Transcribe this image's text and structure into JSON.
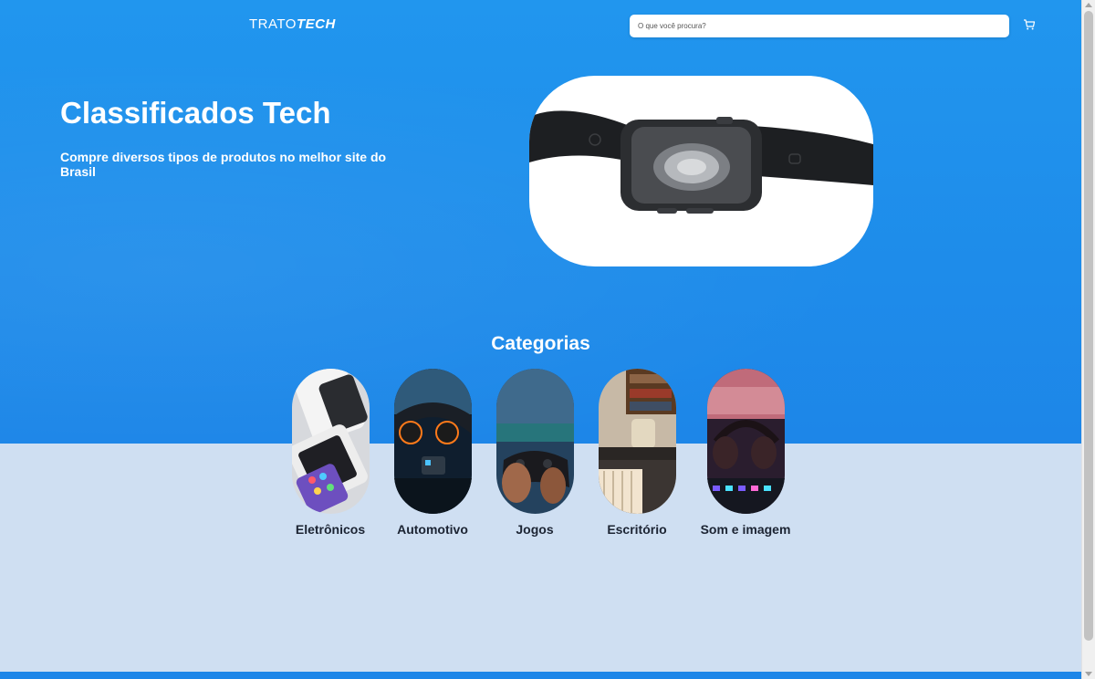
{
  "header": {
    "logo_light": "TRATO",
    "logo_bold": "TECH",
    "search_placeholder": "O que você procura?",
    "cart_icon": "cart-icon"
  },
  "hero": {
    "title": "Classificados Tech",
    "subtitle": "Compre diversos tipos de produtos no melhor site do Brasil",
    "image": "smartwatch-photo"
  },
  "categories": {
    "title": "Categorias",
    "items": [
      {
        "label": "Eletrônicos",
        "image": "phones-and-watch-photo"
      },
      {
        "label": "Automotivo",
        "image": "car-dashboard-photo"
      },
      {
        "label": "Jogos",
        "image": "game-controller-photo"
      },
      {
        "label": "Escritório",
        "image": "office-photo"
      },
      {
        "label": "Som e imagem",
        "image": "headphones-studio-photo"
      }
    ]
  },
  "colors": {
    "primary": "#1e8cea",
    "lower_bg": "#cfdff2",
    "text_dark": "#1c2433"
  }
}
